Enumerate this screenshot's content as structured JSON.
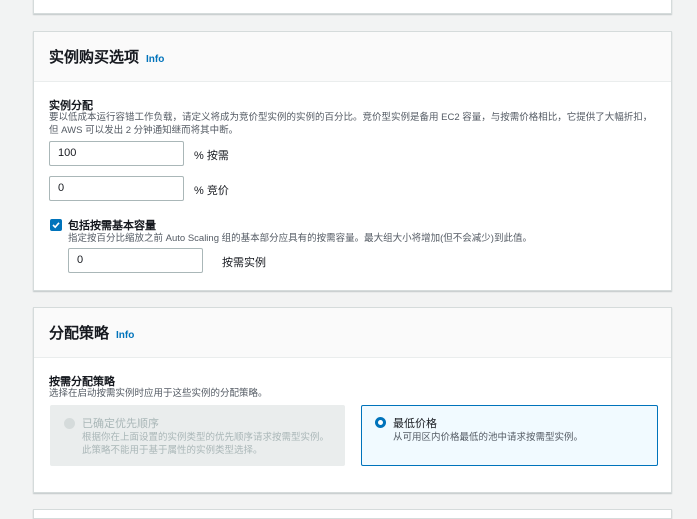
{
  "instance_purchase": {
    "title": "实例购买选项",
    "info": "Info",
    "distribution_label": "实例分配",
    "distribution_desc_1": "要以低成本运行容错工作负载，请定义将成为竞价型实例的实例的百分比。竞价型实例是备用 EC2 容量，与按需价格相比，它提供了大幅折扣，",
    "distribution_desc_2": "但 AWS 可以发出 2 分钟通知继而将其中断。",
    "on_demand_value": "100",
    "on_demand_suffix": "% 按需",
    "spot_value": "0",
    "spot_suffix": "% 竞价",
    "include_base_label": "包括按需基本容量",
    "include_base_checked": true,
    "include_base_desc": "指定按百分比缩放之前 Auto Scaling 组的基本部分应具有的按需容量。最大组大小将增加(但不会减少)到此值。",
    "base_value": "0",
    "base_suffix": "按需实例"
  },
  "allocation": {
    "title": "分配策略",
    "info": "Info",
    "strategy_label": "按需分配策略",
    "strategy_desc": "选择在启动按需实例时应用于这些实例的分配策略。",
    "options": [
      {
        "title": "已确定优先顺序",
        "desc_1": "根据你在上面设置的实例类型的优先顺序请求按需型实例。",
        "desc_2": "此策略不能用于基于属性的实例类型选择。",
        "disabled": true,
        "selected": false
      },
      {
        "title": "最低价格",
        "desc_1": "从可用区内价格最低的池中请求按需型实例。",
        "disabled": false,
        "selected": true
      }
    ]
  },
  "colors": {
    "accent": "#0073bb",
    "background": "#f2f3f3",
    "panel": "#ffffff",
    "disabled": "#eaeded"
  }
}
